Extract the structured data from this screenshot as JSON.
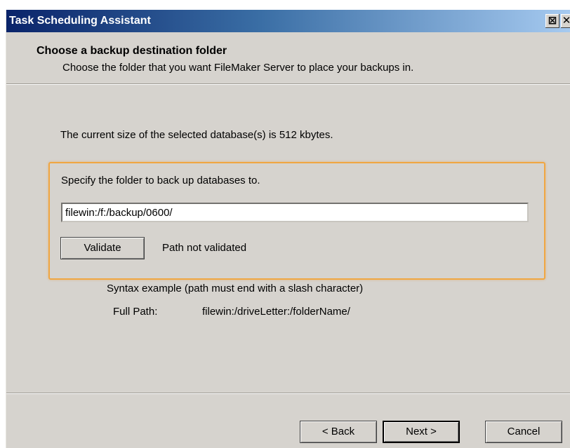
{
  "window": {
    "title": "Task Scheduling Assistant",
    "title_buttons": {
      "pin": "⊠",
      "close": "✕"
    }
  },
  "header": {
    "title": "Choose a backup destination folder",
    "subtitle": "Choose the folder that you want FileMaker Server to place your backups in."
  },
  "main": {
    "size_text": "The current size of the selected database(s) is 512 kbytes.",
    "group_label": "Specify the folder to back up databases to.",
    "path_value": "filewin:/f:/backup/0600/",
    "validate_label": "Validate",
    "status": "Path not validated",
    "syntax_example": "Syntax example (path must end with a slash character)",
    "full_path_label": "Full Path:",
    "full_path_example": "filewin:/driveLetter:/folderName/"
  },
  "footer": {
    "back_label": "< Back",
    "next_label": "Next >",
    "cancel_label": "Cancel"
  },
  "colors": {
    "titlebar_start": "#0a246a",
    "titlebar_end": "#a6caf0",
    "dialog_bg": "#d6d3ce",
    "highlight_border": "#f0a642"
  }
}
